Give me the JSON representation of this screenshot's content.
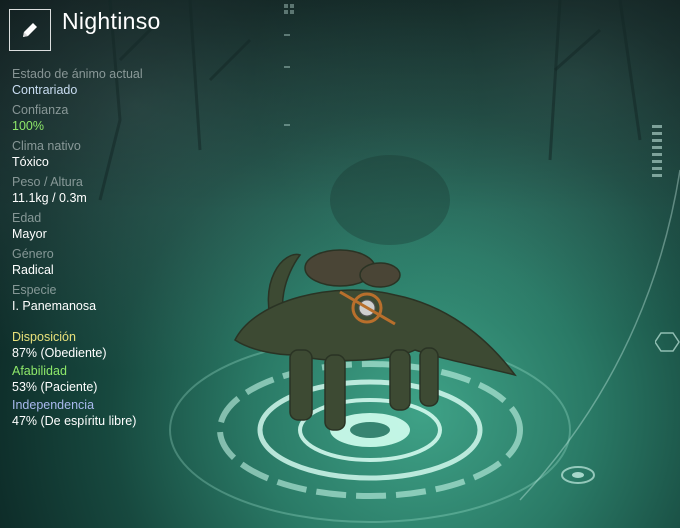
{
  "pet": {
    "name": "Nightinso"
  },
  "icons": {
    "edit": "pencil-icon"
  },
  "stats": [
    {
      "label": "Estado de ánimo actual",
      "value": "Contrariado",
      "color": "#c9ddf2"
    },
    {
      "label": "Confianza",
      "value": "100%",
      "color": "#8ee86a"
    },
    {
      "label": "Clima nativo",
      "value": "Tóxico",
      "color": "#ffffff"
    },
    {
      "label": "Peso / Altura",
      "value": "11.1kg / 0.3m",
      "color": "#ffffff"
    },
    {
      "label": "Edad",
      "value": "Mayor",
      "color": "#ffffff"
    },
    {
      "label": "Género",
      "value": "Radical",
      "color": "#ffffff"
    },
    {
      "label": "Especie",
      "value": "I. Panemanosa",
      "color": "#ffffff"
    }
  ],
  "traits": [
    {
      "label": "Disposición",
      "value": "87% (Obediente)",
      "color": "#e8e07a"
    },
    {
      "label": "Afabilidad",
      "value": "53% (Paciente)",
      "color": "#8ee86a"
    },
    {
      "label": "Independencia",
      "value": "47% (De espíritu libre)",
      "color": "#a9b9ee"
    }
  ]
}
